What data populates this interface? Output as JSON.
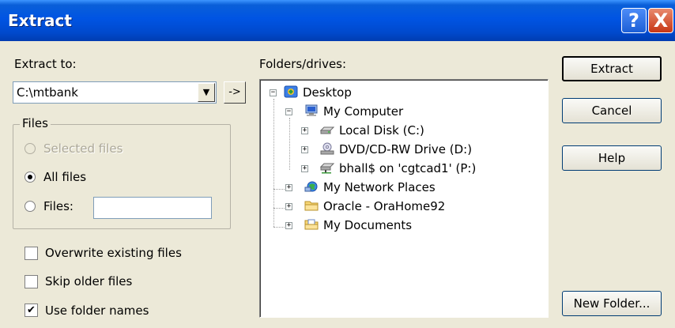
{
  "window": {
    "title": "Extract",
    "help_glyph": "?",
    "close_glyph": "X"
  },
  "extract_to": {
    "label": "Extract to:",
    "value": "C:\\mtbank",
    "dropdown_glyph": "▼",
    "browse_glyph": "->"
  },
  "files_group": {
    "title": "Files",
    "options": [
      {
        "label": "Selected files",
        "checked": false,
        "disabled": true
      },
      {
        "label": "All files",
        "checked": true,
        "disabled": false
      },
      {
        "label": "Files:",
        "checked": false,
        "disabled": false
      }
    ],
    "files_value": ""
  },
  "checkboxes": [
    {
      "label": "Overwrite existing files",
      "checked": false
    },
    {
      "label": "Skip older files",
      "checked": false
    },
    {
      "label": "Use folder names",
      "checked": true
    }
  ],
  "folders": {
    "label": "Folders/drives:",
    "tree": [
      {
        "label": "Desktop",
        "icon": "desktop-icon",
        "expander": "−"
      },
      {
        "label": "My Computer",
        "icon": "my-computer-icon",
        "expander": "−"
      },
      {
        "label": "Local Disk (C:)",
        "icon": "hard-disk-icon",
        "expander": "+"
      },
      {
        "label": "DVD/CD-RW Drive (D:)",
        "icon": "cd-drive-icon",
        "expander": "+"
      },
      {
        "label": "bhall$ on 'cgtcad1' (P:)",
        "icon": "network-drive-icon",
        "expander": "+"
      },
      {
        "label": "My Network Places",
        "icon": "network-places-icon",
        "expander": "+"
      },
      {
        "label": "Oracle - OraHome92",
        "icon": "folder-icon",
        "expander": "+"
      },
      {
        "label": "My Documents",
        "icon": "my-documents-icon",
        "expander": "+"
      }
    ]
  },
  "buttons": {
    "extract": "Extract",
    "cancel": "Cancel",
    "help": "Help",
    "new_folder": "New Folder..."
  },
  "colors": {
    "titlebar": "#0054e3",
    "dialog_bg": "#ece9d8",
    "close_button": "#c73614"
  }
}
